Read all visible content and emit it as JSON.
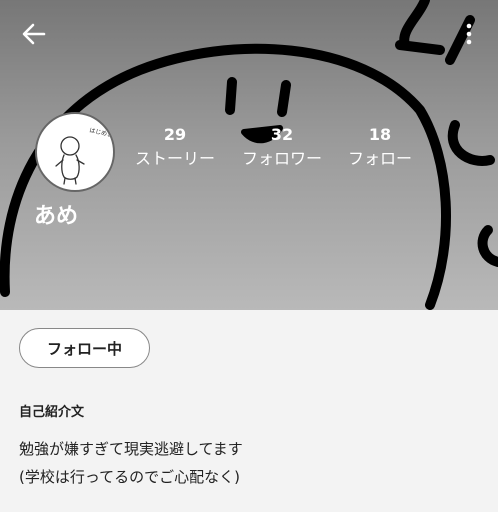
{
  "header": {
    "back_icon": "arrow-left-icon",
    "more_icon": "more-vertical-icon"
  },
  "profile": {
    "avatar_text": "はじめまして",
    "username": "あめ",
    "stats": [
      {
        "value": "29",
        "label": "ストーリー"
      },
      {
        "value": "32",
        "label": "フォロワー"
      },
      {
        "value": "18",
        "label": "フォロー"
      }
    ]
  },
  "follow_button": {
    "label": "フォロー中"
  },
  "bio": {
    "heading": "自己紹介文",
    "lines": [
      "勉強が嫌すぎて現実逃避してます",
      "(学校は行ってるのでご心配なく)"
    ]
  },
  "colors": {
    "text": "#222222",
    "page_bg": "#f3f3f3",
    "header_text": "#ffffff"
  }
}
